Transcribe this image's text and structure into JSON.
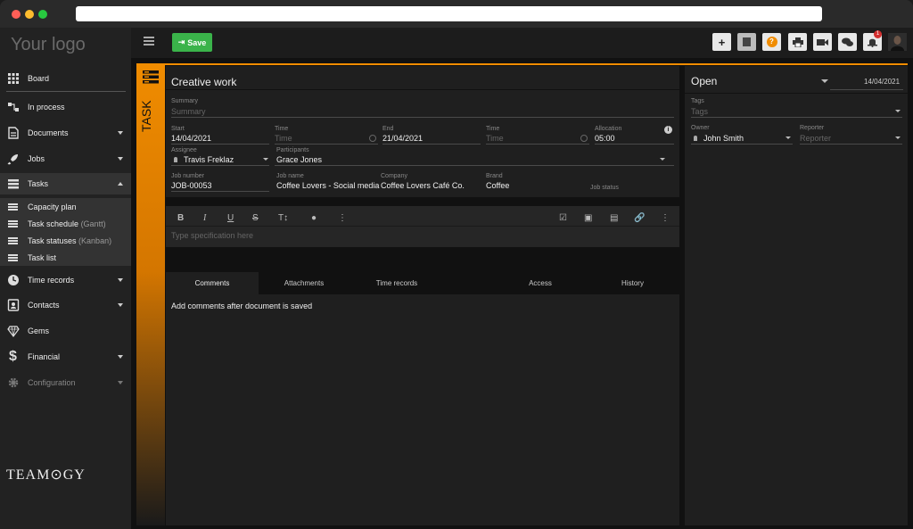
{
  "sidebar": {
    "logo": "Your logo",
    "items": [
      {
        "label": "Board"
      },
      {
        "label": "In process"
      },
      {
        "label": "Documents"
      },
      {
        "label": "Jobs"
      },
      {
        "label": "Tasks"
      },
      {
        "label": "Time records"
      },
      {
        "label": "Contacts"
      },
      {
        "label": "Gems"
      },
      {
        "label": "Financial"
      },
      {
        "label": "Configuration"
      }
    ],
    "subitems": [
      {
        "label": "Capacity plan",
        "muted": ""
      },
      {
        "label": "Task schedule",
        "muted": "(Gantt)"
      },
      {
        "label": "Task statuses",
        "muted": "(Kanban)"
      },
      {
        "label": "Task list",
        "muted": ""
      }
    ],
    "brand": "TEAM⊙GY"
  },
  "toolbar": {
    "save_label": "Save",
    "notification_count": "1"
  },
  "task": {
    "side_label": "TASK",
    "title": "Creative work",
    "summary_label": "Summary",
    "summary_placeholder": "Summary",
    "start_label": "Start",
    "start_value": "14/04/2021",
    "time1_label": "Time",
    "time1_placeholder": "Time",
    "end_label": "End",
    "end_value": "21/04/2021",
    "time2_label": "Time",
    "time2_placeholder": "Time",
    "allocation_label": "Allocation",
    "allocation_value": "05:00",
    "assignee_label": "Assignee",
    "assignee_value": "Travis Freklaz",
    "participants_label": "Participants",
    "participants_value": "Grace Jones",
    "jobnumber_label": "Job number",
    "jobnumber_value": "JOB-00053",
    "jobname_label": "Job name",
    "jobname_value": "Coffee Lovers - Social media",
    "company_label": "Company",
    "company_value": "Coffee Lovers Café Co.",
    "brand_label": "Brand",
    "brand_value": "Coffee",
    "jobstatus_label": "Job status"
  },
  "editor": {
    "placeholder": "Type specification here"
  },
  "tabs": [
    {
      "label": "Comments"
    },
    {
      "label": "Attachments"
    },
    {
      "label": "Time records"
    },
    {
      "label": "Access"
    },
    {
      "label": "History"
    }
  ],
  "comments_message": "Add comments after document is saved",
  "right": {
    "status": "Open",
    "date": "14/04/2021",
    "tags_label": "Tags",
    "tags_placeholder": "Tags",
    "owner_label": "Owner",
    "owner_value": "John Smith",
    "reporter_label": "Reporter",
    "reporter_placeholder": "Reporter"
  },
  "colors": {
    "accent": "#f08c00",
    "save": "#3ab34a"
  }
}
